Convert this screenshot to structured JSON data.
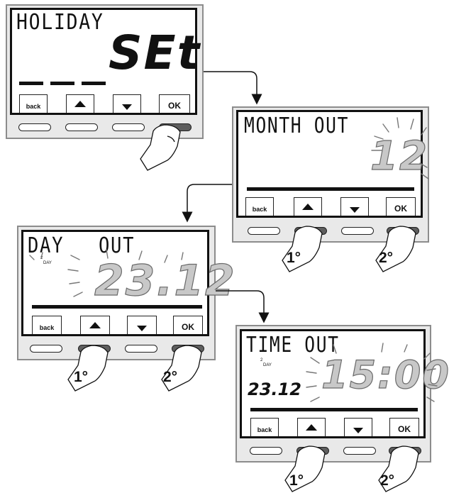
{
  "panels": [
    {
      "title": "HOLIDAY",
      "display": "SEt",
      "keys": [
        "back",
        "OK"
      ]
    },
    {
      "title": "MONTH OUT",
      "display": "12",
      "keys": [
        "back",
        "OK"
      ],
      "steps": [
        "1°",
        "2°"
      ]
    },
    {
      "title_left": "DAY",
      "title_right": "OUT",
      "day_number": "2",
      "day_label": "DAY",
      "display": "23.12",
      "keys": [
        "back",
        "OK"
      ],
      "steps": [
        "1°",
        "2°"
      ]
    },
    {
      "title": "TIME OUT",
      "day_number": "2",
      "day_label": "DAY",
      "date": "23.12",
      "display": "15:00",
      "keys": [
        "back",
        "OK"
      ],
      "steps": [
        "1°",
        "2°"
      ]
    }
  ]
}
